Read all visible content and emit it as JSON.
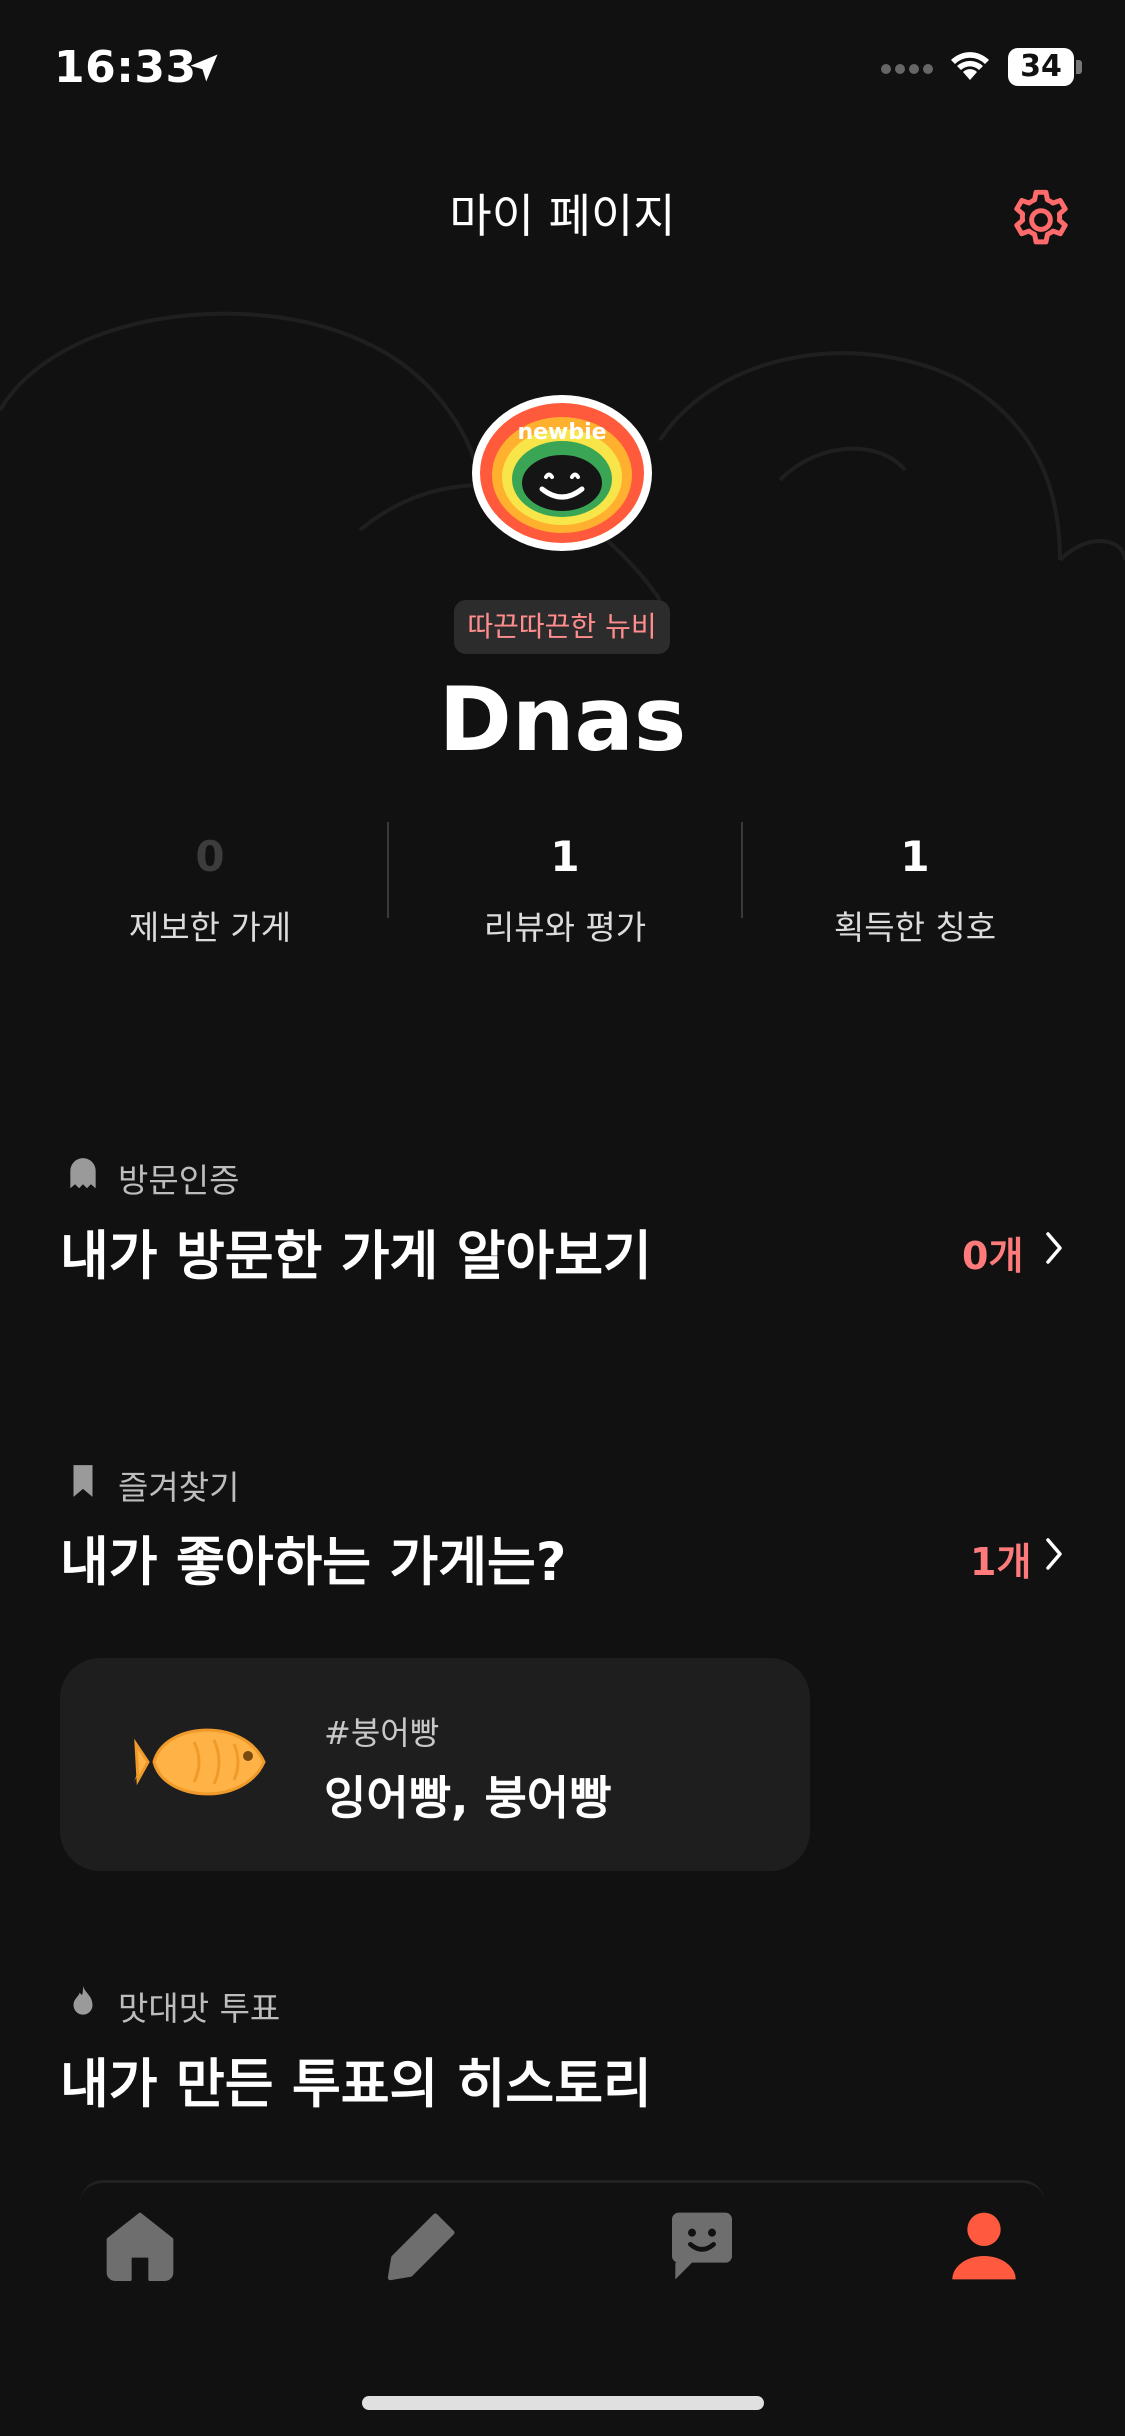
{
  "status_bar": {
    "time": "16:33",
    "battery": "34"
  },
  "header": {
    "title": "마이 페이지"
  },
  "profile": {
    "badge_text": "newbie",
    "title_chip": "따끈따끈한 뉴비",
    "username": "Dnas"
  },
  "stats": [
    {
      "value": "0",
      "label": "제보한 가게"
    },
    {
      "value": "1",
      "label": "리뷰와 평가"
    },
    {
      "value": "1",
      "label": "획득한 칭호"
    }
  ],
  "sections": {
    "visit": {
      "label": "방문인증",
      "title": "내가 방문한 가게 알아보기",
      "count": "0개"
    },
    "favorites": {
      "label": "즐겨찾기",
      "title": "내가 좋아하는 가게는?",
      "count": "1개",
      "card": {
        "tag": "#붕어빵",
        "name": "잉어빵, 붕어빵"
      }
    },
    "votes": {
      "label": "맛대맛 투표",
      "title": "내가 만든 투표의 히스토리"
    }
  },
  "tabs": [
    {
      "name": "home",
      "icon": "home-icon"
    },
    {
      "name": "write",
      "icon": "pencil-icon"
    },
    {
      "name": "community",
      "icon": "chat-icon"
    },
    {
      "name": "mypage",
      "icon": "person-icon",
      "active": true
    }
  ],
  "colors": {
    "accent": "#ff5a40",
    "highlight": "#ff7b7b",
    "background": "#111111"
  }
}
